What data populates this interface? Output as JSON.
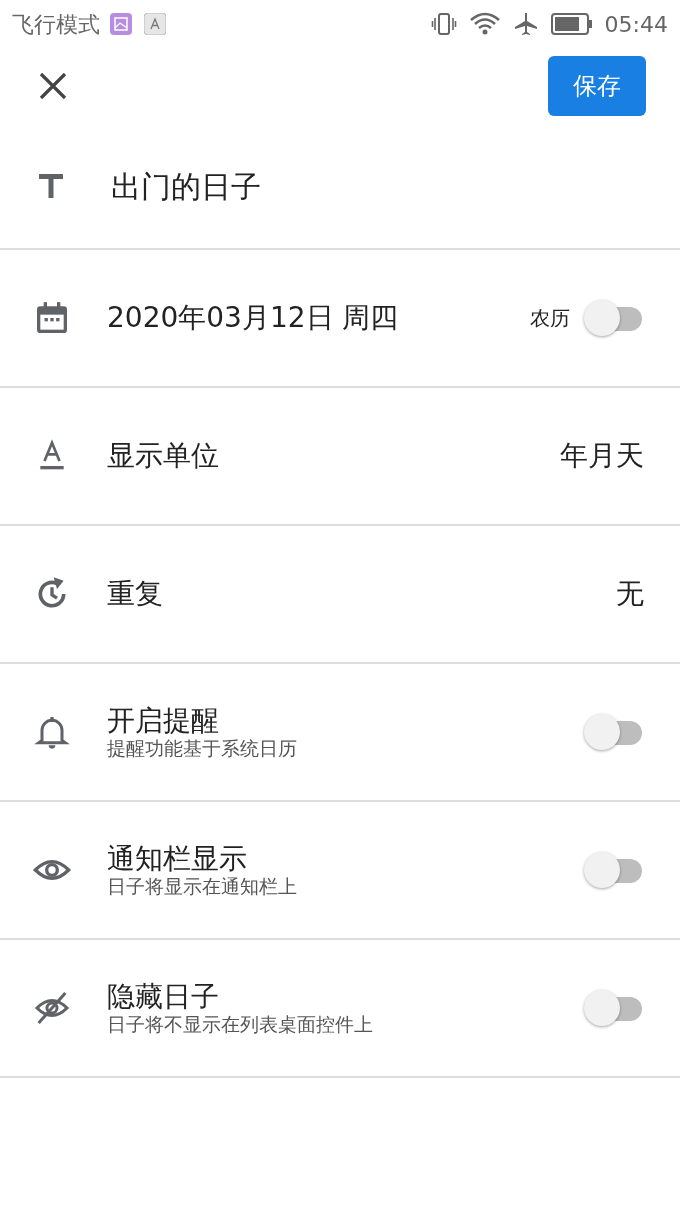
{
  "status_bar": {
    "mode_text": "飞行模式",
    "time": "05:44"
  },
  "header": {
    "save_label": "保存"
  },
  "title": "出门的日子",
  "rows": [
    {
      "kind": "date",
      "label": "2020年03月12日 周四",
      "toggle_label": "农历",
      "on": false
    },
    {
      "kind": "value",
      "label": "显示单位",
      "value": "年月天"
    },
    {
      "kind": "value",
      "label": "重复",
      "value": "无"
    },
    {
      "kind": "switch",
      "label": "开启提醒",
      "sublabel": "提醒功能基于系统日历",
      "on": false
    },
    {
      "kind": "switch",
      "label": "通知栏显示",
      "sublabel": "日子将显示在通知栏上",
      "on": false
    },
    {
      "kind": "switch",
      "label": "隐藏日子",
      "sublabel": "日子将不显示在列表桌面控件上",
      "on": false
    }
  ]
}
